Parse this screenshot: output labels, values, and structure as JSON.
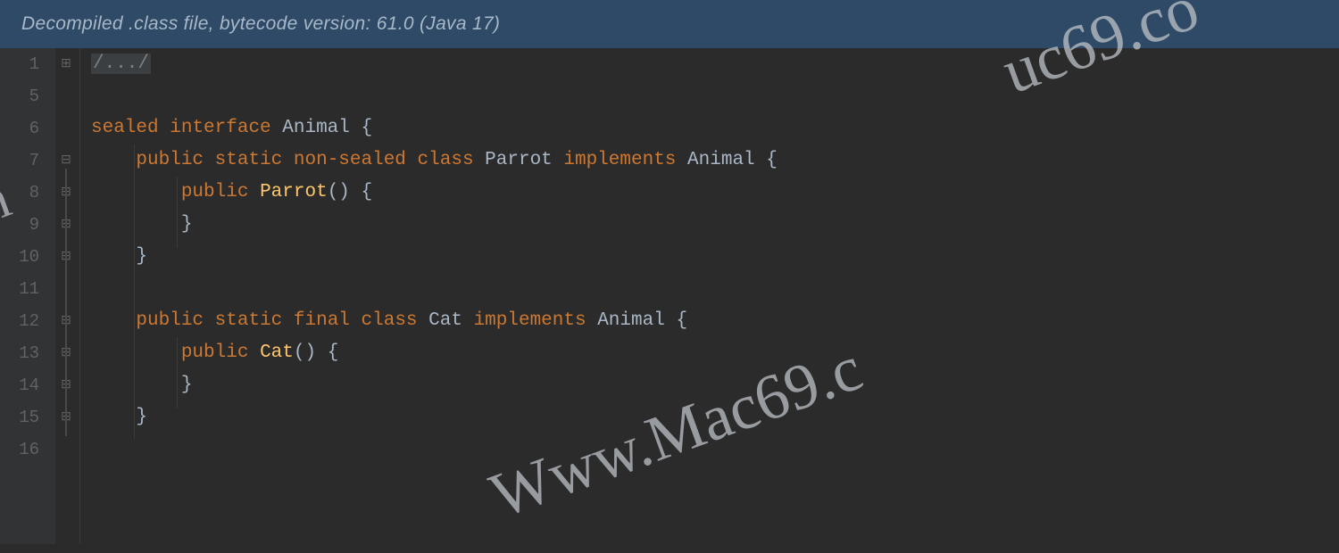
{
  "banner": "Decompiled .class file, bytecode version: 61.0 (Java 17)",
  "lineNumbers": [
    "1",
    "5",
    "6",
    "7",
    "8",
    "9",
    "10",
    "11",
    "12",
    "13",
    "14",
    "15",
    "16"
  ],
  "folded": "/.../",
  "code": {
    "l6": {
      "sealed": "sealed",
      "interface": "interface",
      "Animal": "Animal",
      "ob": "{"
    },
    "l7": {
      "public": "public",
      "static": "static",
      "nonsealed": "non-sealed",
      "class": "class",
      "Parrot": "Parrot",
      "implements": "implements",
      "Animal": "Animal",
      "ob": "{"
    },
    "l8": {
      "public": "public",
      "Parrot": "Parrot",
      "parens": "()",
      "ob": "{"
    },
    "l9": {
      "cb": "}"
    },
    "l10": {
      "cb": "}"
    },
    "l12": {
      "public": "public",
      "static": "static",
      "final": "final",
      "class": "class",
      "Cat": "Cat",
      "implements": "implements",
      "Animal": "Animal",
      "ob": "{"
    },
    "l13": {
      "public": "public",
      "Cat": "Cat",
      "parens": "()",
      "ob": "{"
    },
    "l14": {
      "cb": "}"
    },
    "l15": {
      "cb": "}"
    }
  },
  "watermark": {
    "main": "Www.Mac69.c",
    "top": "uc69.co",
    "left": "m"
  }
}
